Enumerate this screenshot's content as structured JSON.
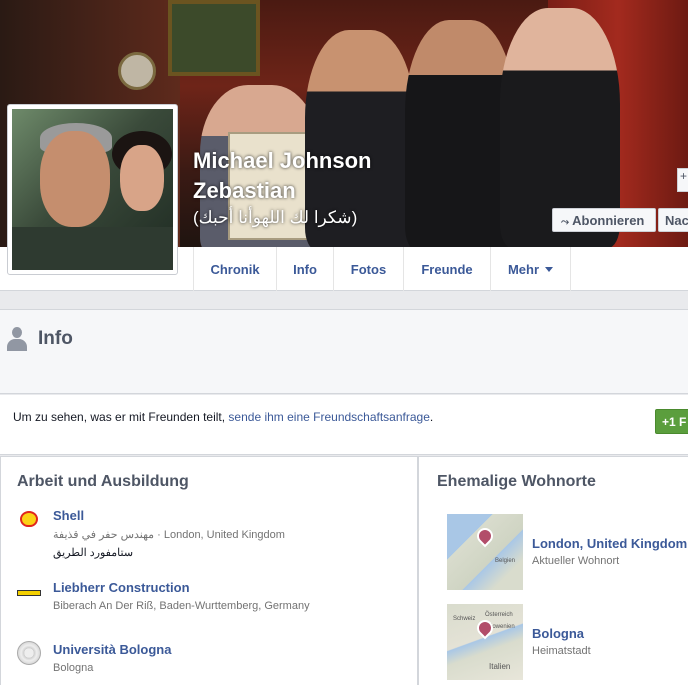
{
  "profile": {
    "name_line1": "Michael Johnson",
    "name_line2": "Zebastian",
    "alternate_name": "(شكرا لك اللهوأنا أحبك)"
  },
  "cover_actions": {
    "subscribe_label": "Abonnieren",
    "message_label": "Nac",
    "plus_label": "+"
  },
  "nav": {
    "tabs": [
      {
        "label": "Chronik"
      },
      {
        "label": "Info"
      },
      {
        "label": "Fotos"
      },
      {
        "label": "Freunde"
      },
      {
        "label": "Mehr"
      }
    ]
  },
  "info": {
    "title": "Info"
  },
  "notice": {
    "text_before": "Um zu sehen, was er mit Freunden teilt, ",
    "link_text": "sende ihm eine Freundschaftsanfrage",
    "text_after": ".",
    "add_friend_label": "+1 F"
  },
  "work_education": {
    "title": "Arbeit und Ausbildung",
    "items": [
      {
        "name": "Shell",
        "detail": "مهندس حفر في قذيفة · London, United Kingdom",
        "detail2": "ستامفورد الطريق",
        "icon": "shell-logo"
      },
      {
        "name": "Liebherr Construction",
        "detail": "Biberach An Der Riß, Baden-Wurttemberg, Germany",
        "icon": "liebherr-logo"
      },
      {
        "name": "Università Bologna",
        "detail": "Bologna",
        "icon": "university-seal"
      }
    ]
  },
  "places": {
    "title": "Ehemalige Wohnorte",
    "items": [
      {
        "name": "London, United Kingdom",
        "detail": "Aktueller Wohnort",
        "map_label_1": "Belgien"
      },
      {
        "name": "Bologna",
        "detail": "Heimatstadt",
        "map_label_1": "Österreich",
        "map_label_2": "Schweiz",
        "map_label_3": "Slowenien",
        "map_label_4": "Italien"
      }
    ]
  }
}
